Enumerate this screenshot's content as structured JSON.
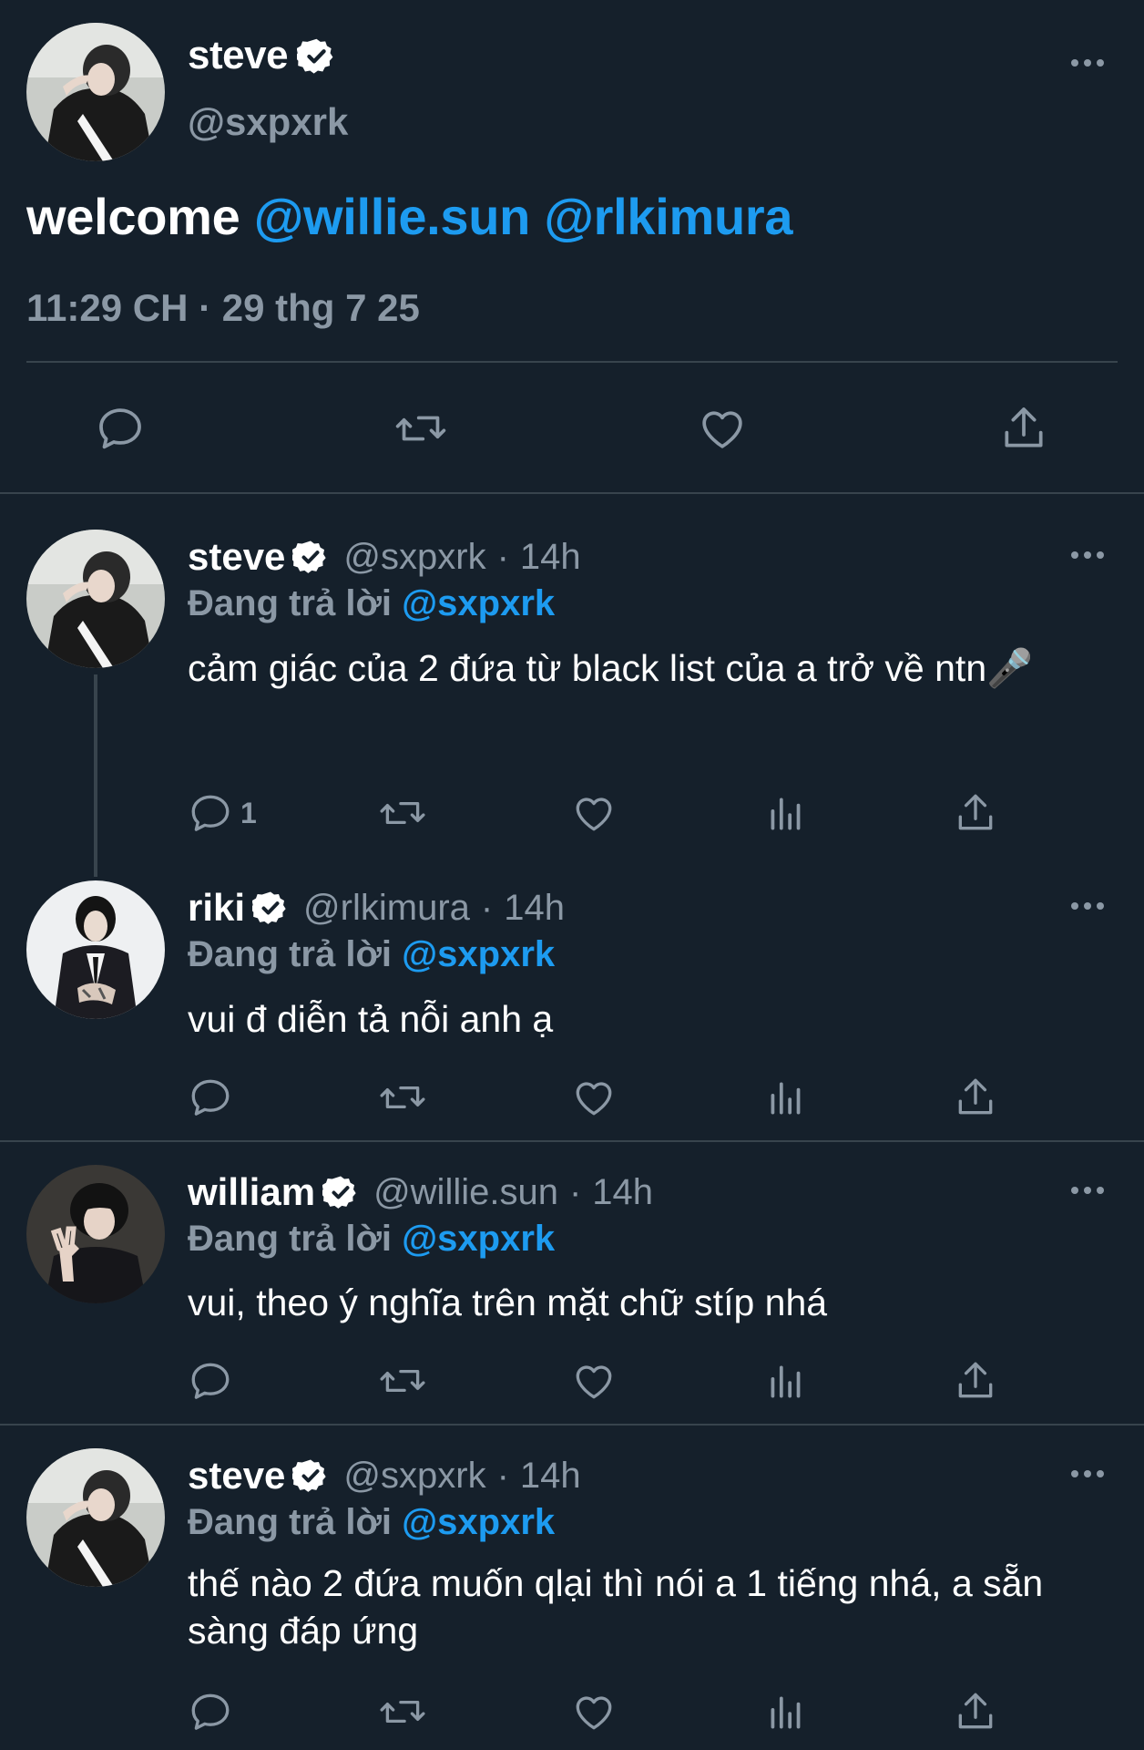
{
  "colors": {
    "background": "#15202b",
    "accent": "#1d9bf0",
    "muted": "#8b98a5",
    "divider": "#38444d"
  },
  "main_tweet": {
    "name": "steve",
    "handle": "@sxpxrk",
    "text": "welcome",
    "mentions": [
      "@willie.sun",
      "@rlkimura"
    ],
    "meta": "11:29 CH · 29 thg 7 25"
  },
  "replies": [
    {
      "name": "steve",
      "handle": "@sxpxrk",
      "time": "14h",
      "replying_prefix": "Đang trả lời",
      "replying_to": "@sxpxrk",
      "text": "cảm giác của 2 đứa từ black list của a trở về ntn🎤",
      "reply_count": "1"
    },
    {
      "name": "riki",
      "handle": "@rlkimura",
      "time": "14h",
      "replying_prefix": "Đang trả lời",
      "replying_to": "@sxpxrk",
      "text": "vui đ diễn tả nỗi anh ạ",
      "reply_count": ""
    },
    {
      "name": "william",
      "handle": "@willie.sun",
      "time": "14h",
      "replying_prefix": "Đang trả lời",
      "replying_to": "@sxpxrk",
      "text": "vui, theo ý nghĩa trên mặt chữ stíp nhá",
      "reply_count": ""
    },
    {
      "name": "steve",
      "handle": "@sxpxrk",
      "time": "14h",
      "replying_prefix": "Đang trả lời",
      "replying_to": "@sxpxrk",
      "text": "thế nào 2 đứa muốn qlại thì nói a 1 tiếng nhá, a sẵn sàng đáp ứng",
      "reply_count": ""
    }
  ],
  "icons": [
    "reply-icon",
    "retweet-icon",
    "like-icon",
    "views-icon",
    "share-icon",
    "more-icon",
    "verified-icon"
  ]
}
